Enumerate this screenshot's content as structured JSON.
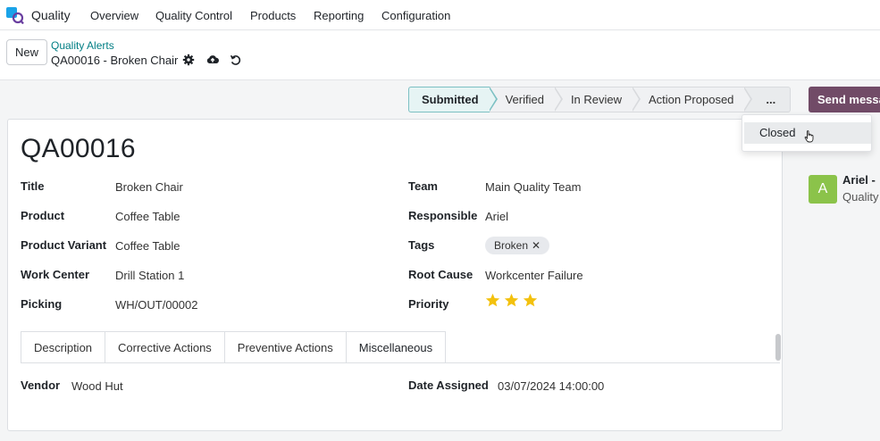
{
  "topnav": {
    "app_name": "Quality",
    "menu": [
      "Overview",
      "Quality Control",
      "Products",
      "Reporting",
      "Configuration"
    ]
  },
  "control": {
    "new_label": "New",
    "breadcrumb": "Quality Alerts",
    "record_name": "QA00016 - Broken Chair"
  },
  "statusbar": {
    "stages": [
      "Submitted",
      "Verified",
      "In Review",
      "Action Proposed"
    ],
    "active_stage": "Submitted",
    "more_label": "...",
    "send_label": "Send messa"
  },
  "dropdown": {
    "items": [
      "Closed"
    ]
  },
  "form": {
    "title": "QA00016",
    "left": [
      {
        "label": "Title",
        "value": "Broken Chair"
      },
      {
        "label": "Product",
        "value": "Coffee Table"
      },
      {
        "label": "Product Variant",
        "value": "Coffee Table"
      },
      {
        "label": "Work Center",
        "value": "Drill Station 1"
      },
      {
        "label": "Picking",
        "value": "WH/OUT/00002"
      }
    ],
    "right": [
      {
        "label": "Team",
        "value": "Main Quality Team"
      },
      {
        "label": "Responsible",
        "value": "Ariel"
      },
      {
        "label": "Tags",
        "value": "Broken"
      },
      {
        "label": "Root Cause",
        "value": "Workcenter Failure"
      },
      {
        "label": "Priority",
        "value": "3"
      }
    ],
    "tabs": [
      "Description",
      "Corrective Actions",
      "Preventive Actions",
      "Miscellaneous"
    ],
    "active_tab": "Miscellaneous",
    "misc": {
      "vendor_label": "Vendor",
      "vendor_value": "Wood Hut",
      "date_label": "Date Assigned",
      "date_value": "03/07/2024 14:00:00"
    }
  },
  "chatter": {
    "avatar_letter": "A",
    "author": "Ariel -",
    "subline": "Quality"
  },
  "colors": {
    "accent": "#714b67",
    "link": "#017e84",
    "star": "#f3c10e",
    "avatar": "#8bc34a"
  }
}
